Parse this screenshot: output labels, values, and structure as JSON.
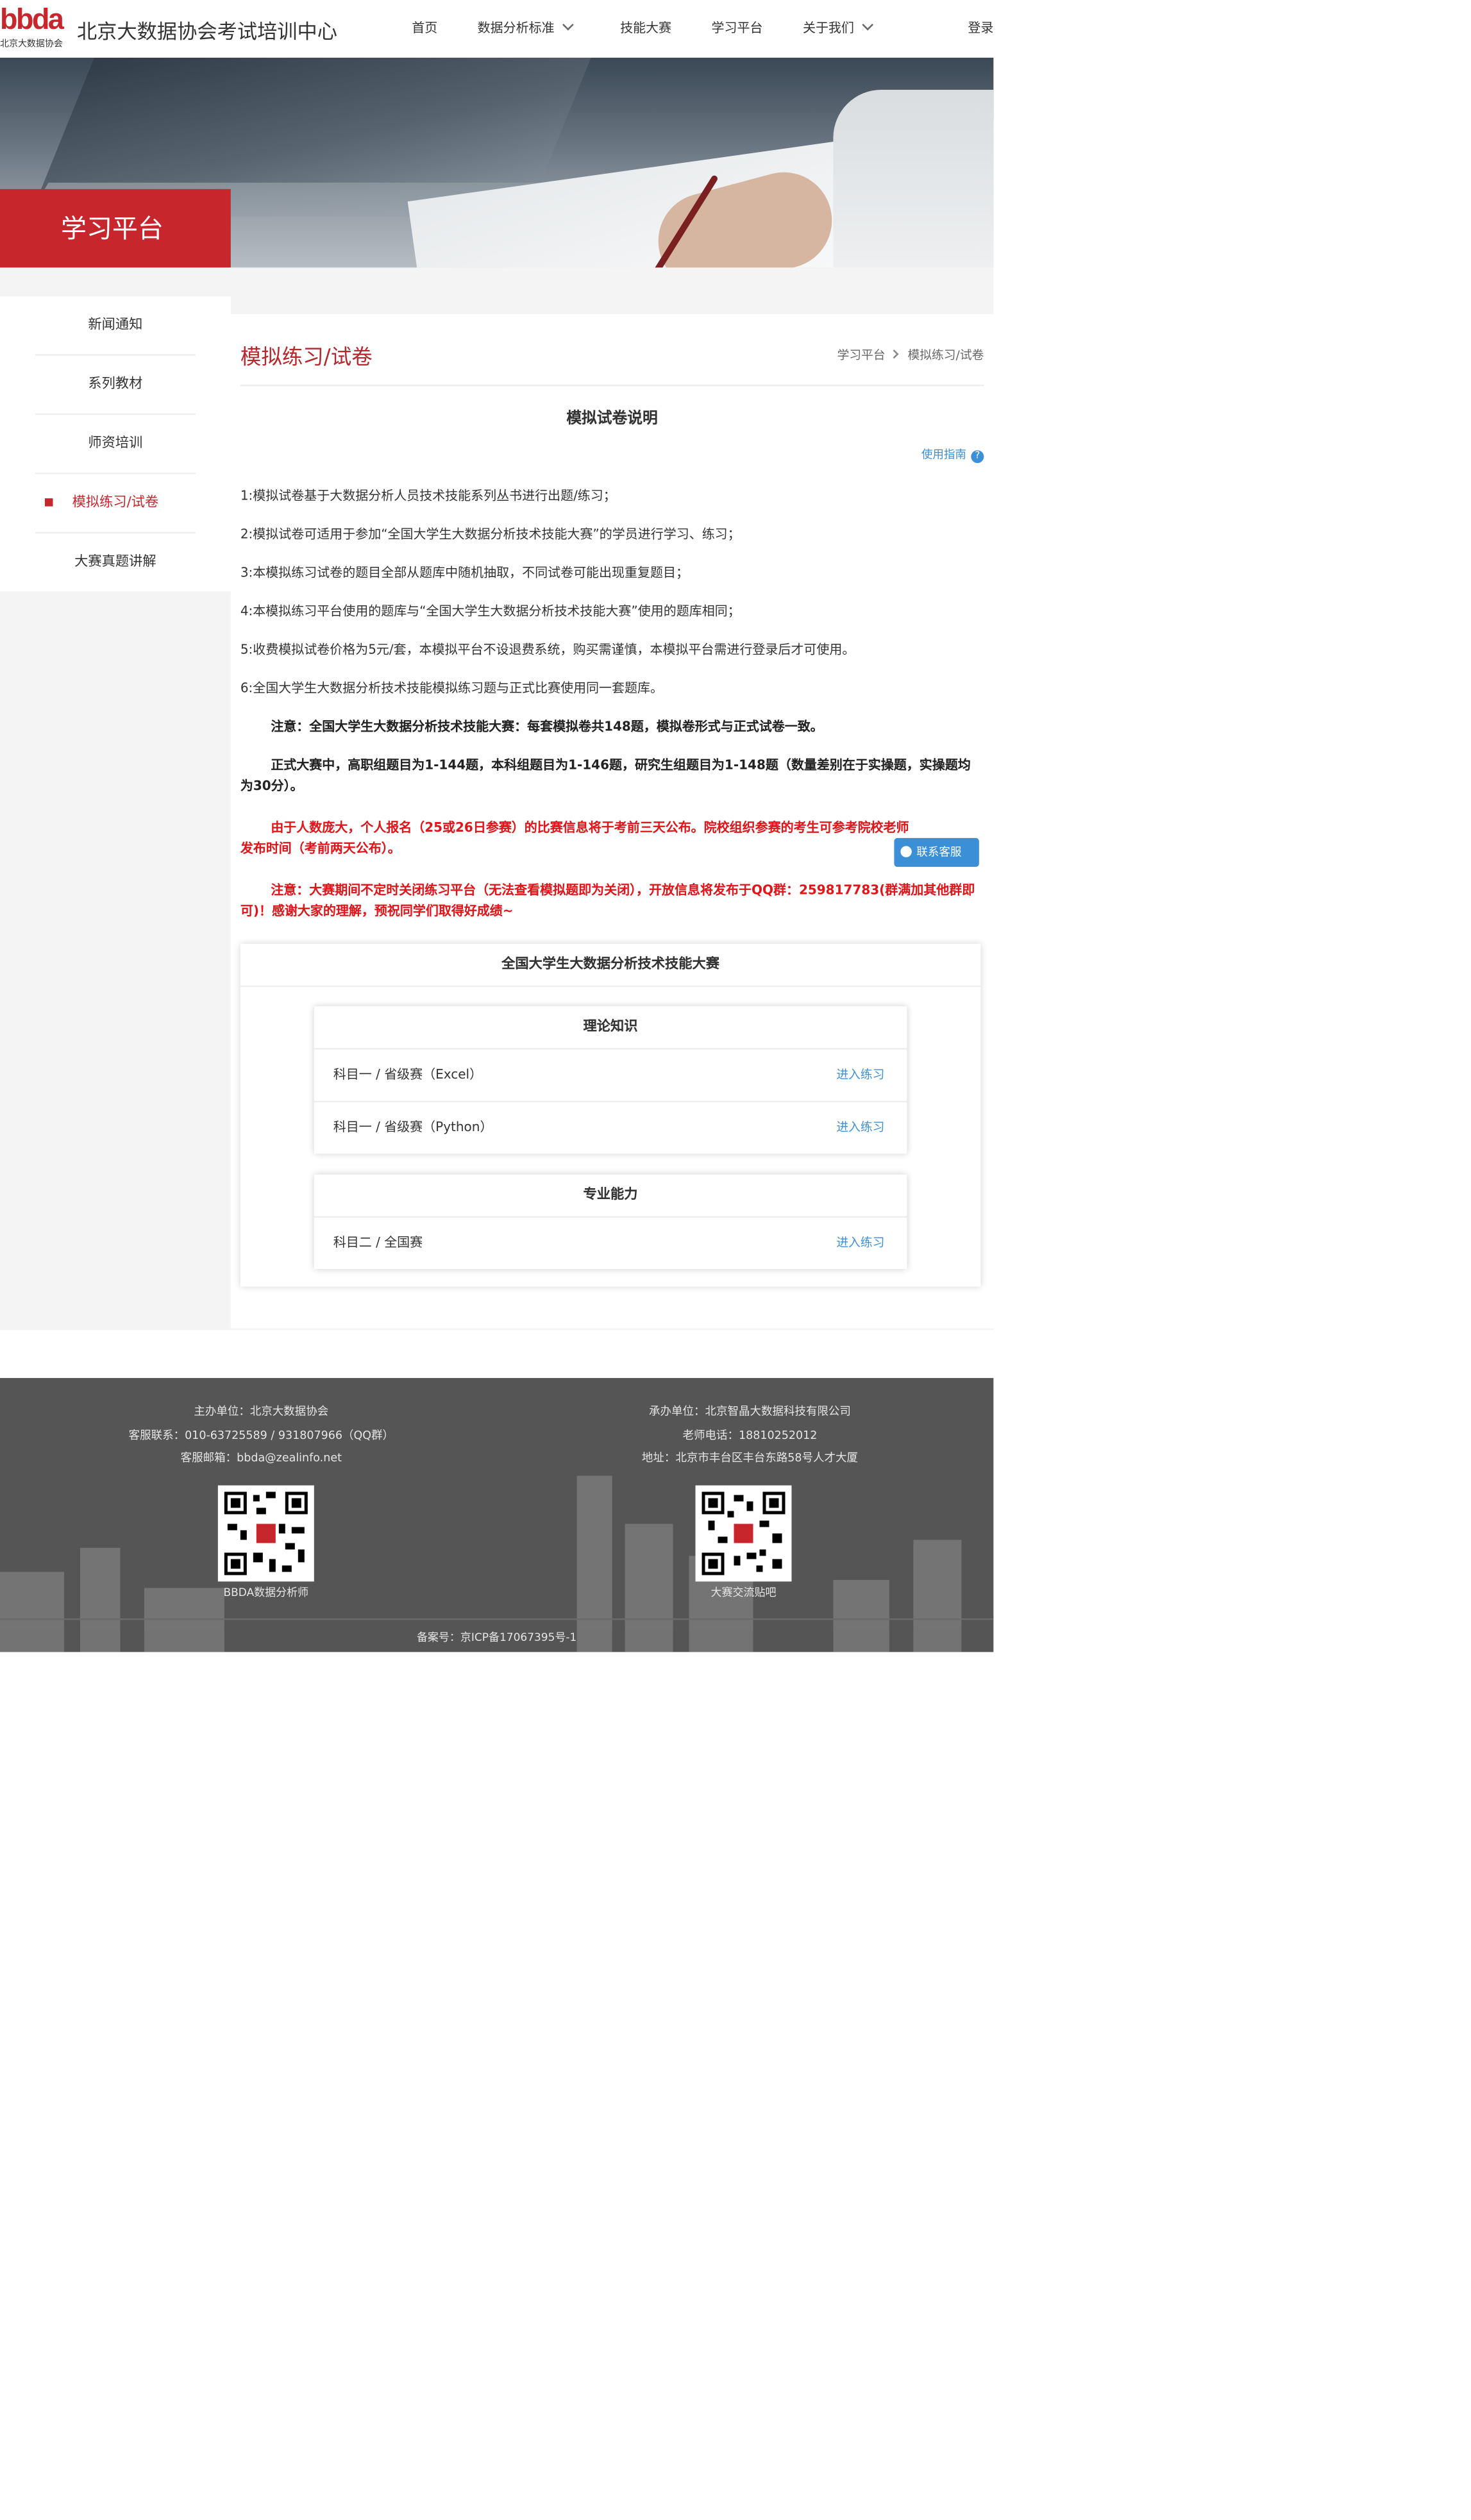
{
  "header": {
    "logo_mark": "bbda",
    "logo_cn": "北京大数据协会",
    "site_title": "北京大数据协会考试培训中心",
    "nav": [
      {
        "label": "首页"
      },
      {
        "label": "数据分析标准"
      },
      {
        "label": "技能大赛"
      },
      {
        "label": "学习平台"
      },
      {
        "label": "关于我们"
      }
    ],
    "login": "登录"
  },
  "banner": {
    "label": "学习平台"
  },
  "sidebar": {
    "items": [
      {
        "label": "新闻通知"
      },
      {
        "label": "系列教材"
      },
      {
        "label": "师资培训"
      },
      {
        "label": "模拟练习/试卷",
        "active": true
      },
      {
        "label": "大赛真题讲解"
      }
    ]
  },
  "main": {
    "title": "模拟练习/试卷",
    "breadcrumb": [
      "学习平台",
      "模拟练习/试卷"
    ],
    "doc_title": "模拟试卷说明",
    "guide_link": "使用指南",
    "guide_icon": "?",
    "rules": [
      "1:模拟试卷基于大数据分析人员技术技能系列丛书进行出题/练习；",
      "2:模拟试卷可适用于参加“全国大学生大数据分析技术技能大赛”的学员进行学习、练习；",
      "3:本模拟练习试卷的题目全部从题库中随机抽取，不同试卷可能出现重复题目；",
      "4:本模拟练习平台使用的题库与“全国大学生大数据分析技术技能大赛”使用的题库相同；",
      "5:收费模拟试卷价格为5元/套，本模拟平台不设退费系统，购买需谨慎，本模拟平台需进行登录后才可使用。",
      "6:全国大学生大数据分析技术技能模拟练习题与正式比赛使用同一套题库。"
    ],
    "notes": [
      "注意：全国大学生大数据分析技术技能大赛：每套模拟卷共148题，模拟卷形式与正式试卷一致。",
      "正式大赛中，高职组题目为1-144题，本科组题目为1-146题，研究生组题目为1-148题（数量差别在于实操题，实操题均为30分）。",
      "由于人数庞大，个人报名（25或26日参赛）的比赛信息将于考前三天公布。院校组织参赛的考生可参考院校老师发布时间（考前两天公布）。",
      "注意：大赛期间不定时关闭练习平台（无法查看模拟题即为关闭），开放信息将发布于QQ群：259817783(群满加其他群即可)！感谢大家的理解，预祝同学们取得好成绩~"
    ],
    "contact_button": "联系客服",
    "competition": {
      "title": "全国大学生大数据分析技术技能大赛",
      "sections": [
        {
          "title": "理论知识",
          "rows": [
            {
              "label": "科目一 / 省级赛（Excel）",
              "action": "进入练习"
            },
            {
              "label": "科目一 / 省级赛（Python）",
              "action": "进入练习"
            }
          ]
        },
        {
          "title": "专业能力",
          "rows": [
            {
              "label": "科目二 / 全国赛",
              "action": "进入练习"
            }
          ]
        }
      ]
    }
  },
  "footer": {
    "left": [
      "主办单位：北京大数据协会",
      "客服联系：010-63725589 / 931807966（QQ群）",
      "客服邮箱：bbda@zealinfo.net"
    ],
    "right": [
      "承办单位：北京智晶大数据科技有限公司",
      "老师电话：18810252012",
      "地址：北京市丰台区丰台东路58号人才大厦"
    ],
    "qr_left_caption": "BBDA数据分析师",
    "qr_right_caption": "大赛交流贴吧",
    "qr_badge": "bbda",
    "icp": "备案号：京ICP备17067395号-1"
  },
  "colors": {
    "brand_red": "#c8262d",
    "link_blue": "#3d8fd8",
    "alert_red": "#e0161b",
    "footer_bg": "#555555"
  }
}
